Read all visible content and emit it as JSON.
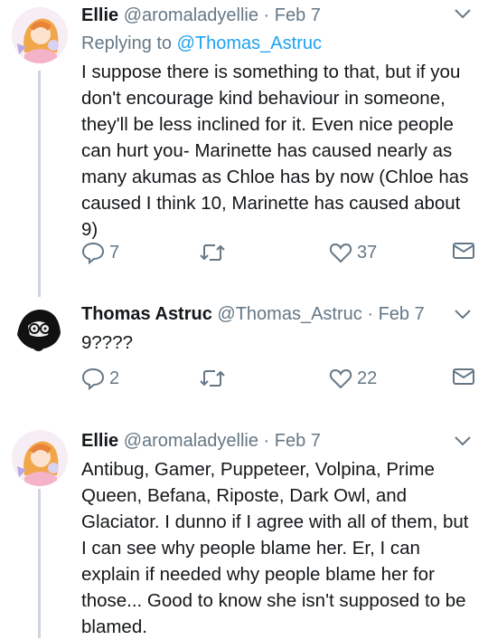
{
  "tweets": [
    {
      "name": "Ellie",
      "handle": "@aromaladyellie",
      "separator": "·",
      "date": "Feb 7",
      "reply_prefix": "Replying to",
      "reply_handle": "@Thomas_Astruc",
      "text": "I suppose there is something to that, but if you don't encourage kind behaviour in someone, they'll be less inclined for it. Even nice people can hurt you- Marinette has caused nearly as many akumas as Chloe has by now (Chloe has caused I think 10, Marinette has caused about 9)",
      "replies": "7",
      "likes": "37"
    },
    {
      "name": "Thomas Astruc",
      "handle": "@Thomas_Astruc",
      "separator": "·",
      "date": "Feb 7",
      "text": "9????",
      "replies": "2",
      "likes": "22"
    },
    {
      "name": "Ellie",
      "handle": "@aromaladyellie",
      "separator": "·",
      "date": "Feb 7",
      "text": "Antibug, Gamer, Puppeteer, Volpina, Prime Queen, Befana, Riposte, Dark Owl, and Glaciator. I dunno if I agree with all of them, but I can see why people blame her. Er, I can explain if needed why people blame her for those... Good to know she isn't supposed to be blamed."
    }
  ],
  "icons": {
    "reply": "reply-icon",
    "retweet": "retweet-icon",
    "like": "heart-icon",
    "dm": "envelope-icon",
    "more": "chevron-down-icon"
  },
  "colors": {
    "link": "#1da1f2",
    "secondary": "#657786",
    "thread_line": "#cfd6dc"
  }
}
